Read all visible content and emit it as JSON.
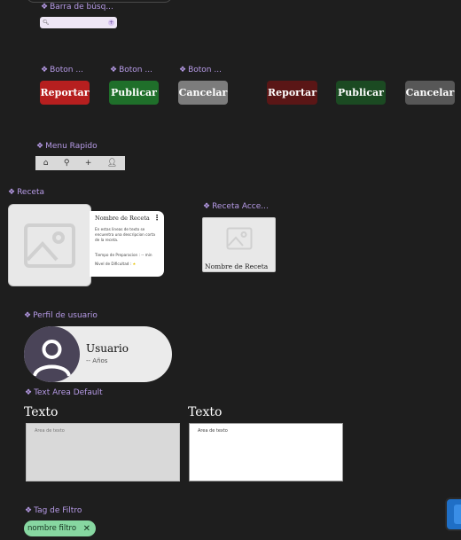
{
  "labels": {
    "search": "Barra de búsq...",
    "btn1": "Boton ...",
    "btn2": "Boton ...",
    "btn3": "Boton ...",
    "quick_menu": "Menu Rapido",
    "recipe": "Receta",
    "recipe_acc": "Receta Acce...",
    "profile": "Perfil de usuario",
    "text_area": "Text Area Default",
    "tag": "Tag de Filtro"
  },
  "search_bar": {
    "icon": "search-icon",
    "action_icon": "add-icon"
  },
  "buttons": {
    "active": {
      "report": "Reportar",
      "publish": "Publicar",
      "cancel": "Cancelar"
    },
    "pressed": {
      "report": "Reportar",
      "publish": "Publicar",
      "cancel": "Cancelar"
    },
    "colors": {
      "report": "#b61f1f",
      "publish": "#1f6f2a",
      "cancel": "#7c7c7c",
      "report_dark": "#5a1616",
      "publish_dark": "#1b4a22",
      "cancel_dark": "#575757"
    }
  },
  "quick_menu": {
    "icons": [
      "home-icon",
      "search-icon",
      "add-icon",
      "user-icon"
    ]
  },
  "recipe": {
    "title": "Nombre de Receta",
    "description": "En estas lineas de texto se encuentra una descripcion corta de la receta.",
    "time": "Tiempo de Preparacion : -- min",
    "difficulty_label": "Nivel de Dificultad : ",
    "difficulty_star": "★"
  },
  "recipe_access": {
    "title": "Nombre de Receta"
  },
  "profile": {
    "name": "Usuario",
    "age": "-- Años"
  },
  "text_area": {
    "default_title": "Texto",
    "default_placeholder": "Area de texto",
    "active_title": "Texto",
    "active_placeholder": "Area de texto"
  },
  "tag": {
    "text": "nombre filtro",
    "close": "✕",
    "color": "#87d7a1"
  }
}
